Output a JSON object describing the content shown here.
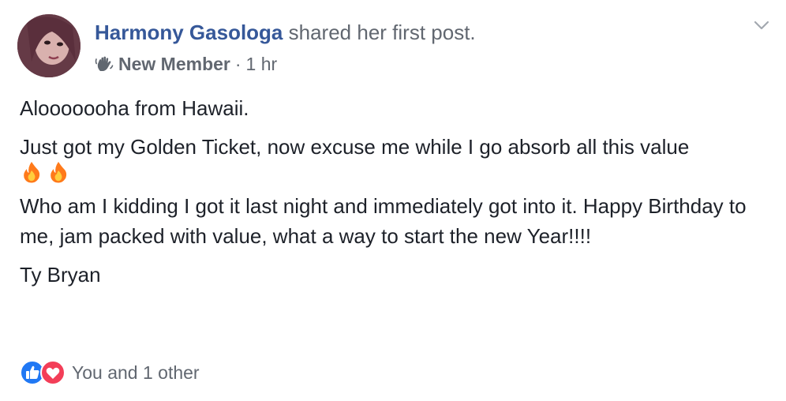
{
  "post": {
    "author_name": "Harmony Gasologa",
    "action_text": "shared her first post.",
    "badge": "New Member",
    "separator": "·",
    "time": "1 hr",
    "paragraphs": [
      "Alooooooha from Hawaii.",
      "Just got my Golden Ticket, now excuse me while I go absorb all this value",
      "Who am I kidding I got it last night and immediately got into it. Happy Birthday to me, jam packed with value, what a way to start the new Year!!!!",
      "Ty Bryan"
    ],
    "emoji": [
      "fire-emoji",
      "fire-emoji"
    ],
    "reactions_text": "You and 1 other"
  },
  "icons": {
    "wave": "waving-hand-icon",
    "menu": "chevron-down-icon",
    "like": "like-reaction-icon",
    "love": "love-reaction-icon"
  },
  "colors": {
    "link": "#365899",
    "secondary_text": "#616770",
    "body_text": "#1d2129",
    "like_blue": "#2078f4",
    "love_red": "#f33e58",
    "fire_orange": "#ff7a1a"
  }
}
